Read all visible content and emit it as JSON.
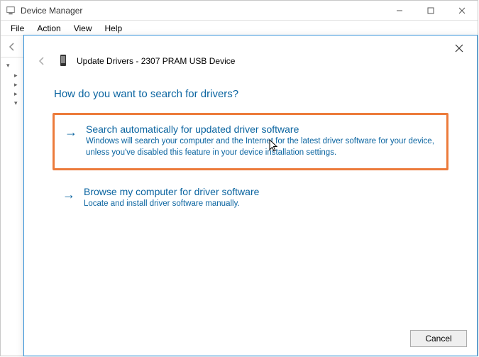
{
  "deviceManager": {
    "title": "Device Manager",
    "menu": {
      "file": "File",
      "action": "Action",
      "view": "View",
      "help": "Help"
    }
  },
  "wizard": {
    "headerTitle": "Update Drivers - 2307 PRAM USB Device",
    "question": "How do you want to search for drivers?",
    "option1": {
      "title": "Search automatically for updated driver software",
      "desc": "Windows will search your computer and the Internet for the latest driver software for your device, unless you've disabled this feature in your device installation settings."
    },
    "option2": {
      "title": "Browse my computer for driver software",
      "desc": "Locate and install driver software manually."
    },
    "cancel": "Cancel"
  }
}
